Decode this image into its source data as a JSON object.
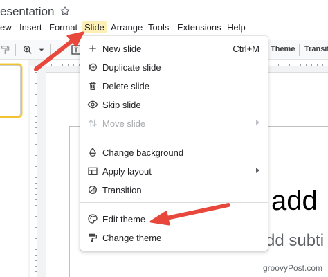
{
  "title": "esentation",
  "menubar": {
    "items": [
      "ew",
      "Insert",
      "Format",
      "Slide",
      "Arrange",
      "Tools",
      "Extensions",
      "Help"
    ],
    "active": "Slide"
  },
  "toolbar": {
    "theme_label": "Theme",
    "transition_label": "Transiti"
  },
  "slide_menu": {
    "items": [
      {
        "label": "New slide",
        "shortcut": "Ctrl+M",
        "icon": "plus-icon"
      },
      {
        "label": "Duplicate slide",
        "icon": "duplicate-icon"
      },
      {
        "label": "Delete slide",
        "icon": "trash-icon"
      },
      {
        "label": "Skip slide",
        "icon": "eye-icon"
      },
      {
        "label": "Move slide",
        "icon": "move-icon",
        "disabled": true,
        "submenu": true
      },
      {
        "label": "Change background",
        "icon": "paint-drop-icon"
      },
      {
        "label": "Apply layout",
        "icon": "layout-icon",
        "submenu": true
      },
      {
        "label": "Transition",
        "icon": "transition-icon"
      },
      {
        "label": "Edit theme",
        "icon": "palette-icon"
      },
      {
        "label": "Change theme",
        "icon": "theme-brush-icon"
      }
    ]
  },
  "slide": {
    "title_fragment": "add",
    "subtitle_fragment": "dd subti"
  },
  "watermark": "groovyPost.com",
  "colors": {
    "active_menu_bg": "#fdf0b6",
    "arrow": "#e8473c",
    "thumb_border": "#f1c232"
  }
}
